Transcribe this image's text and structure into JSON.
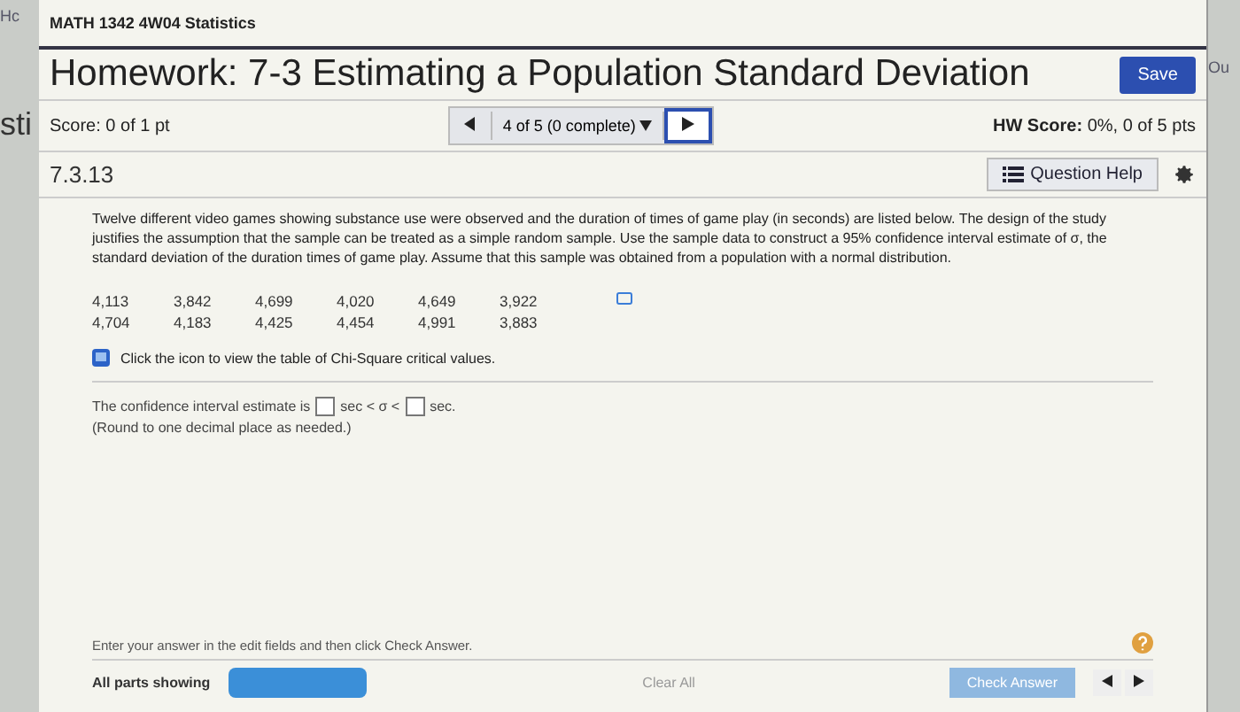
{
  "backdrop": {
    "left_fragments": [
      "Hc",
      "sti"
    ],
    "right_fragment": "Ou"
  },
  "course": {
    "title": "MATH 1342 4W04 Statistics"
  },
  "homework": {
    "title": "Homework: 7-3 Estimating a Population Standard Deviation",
    "save_button": "Save"
  },
  "nav": {
    "score": "Score: 0 of 1 pt",
    "position": "4 of 5 (0 complete)",
    "hw_score_label": "HW Score:",
    "hw_score_value": "0%, 0 of 5 pts"
  },
  "question": {
    "number": "7.3.13",
    "help_button": "Question Help",
    "text": "Twelve different video games showing substance use were observed and the duration of times of game play (in seconds) are listed below. The design of the study justifies the assumption that the sample can be treated as a simple random sample. Use the sample data to construct a 95% confidence interval estimate of σ, the standard deviation of the duration times of game play. Assume that this sample was obtained from a population with a normal distribution.",
    "data_rows": [
      [
        "4,113",
        "3,842",
        "4,699",
        "4,020",
        "4,649",
        "3,922"
      ],
      [
        "4,704",
        "4,183",
        "4,425",
        "4,454",
        "4,991",
        "3,883"
      ]
    ],
    "table_link": "Click the icon to view the table of Chi-Square critical values.",
    "answer_prefix": "The confidence interval estimate is",
    "answer_unit_1": "sec < σ <",
    "answer_unit_2": "sec.",
    "round_note": "(Round to one decimal place as needed.)"
  },
  "footer": {
    "instruction": "Enter your answer in the edit fields and then click Check Answer.",
    "parts_label": "All parts showing",
    "clear_button": "Clear All",
    "check_button": "Check Answer"
  }
}
